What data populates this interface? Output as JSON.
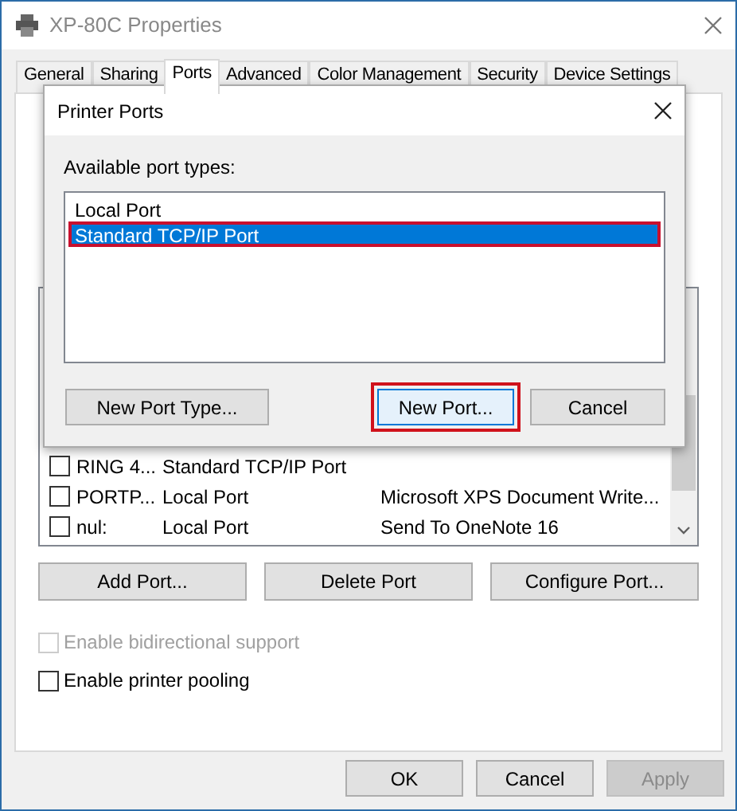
{
  "window": {
    "title": "XP-80C Properties"
  },
  "tabs": [
    {
      "label": "General",
      "selected": false
    },
    {
      "label": "Sharing",
      "selected": false
    },
    {
      "label": "Ports",
      "selected": true
    },
    {
      "label": "Advanced",
      "selected": false
    },
    {
      "label": "Color Management",
      "selected": false
    },
    {
      "label": "Security",
      "selected": false
    },
    {
      "label": "Device Settings",
      "selected": false
    }
  ],
  "ports": [
    {
      "port": "RING 4...",
      "description": "Standard TCP/IP Port",
      "checked": false
    },
    {
      "port": "PORTP...",
      "description": "Local Port",
      "printer": "Microsoft XPS Document Write...",
      "checked": false
    },
    {
      "port": "nul:",
      "description": "Local Port",
      "printer": "Send To OneNote 16",
      "checked": false
    }
  ],
  "port_buttons": [
    "Add Port...",
    "Delete Port",
    "Configure Port..."
  ],
  "options": [
    {
      "label": "Enable bidirectional support",
      "checked": false,
      "disabled": true
    },
    {
      "label": "Enable printer pooling",
      "checked": false,
      "disabled": false
    }
  ],
  "buttons": [
    {
      "label": "OK",
      "disabled": false
    },
    {
      "label": "Cancel",
      "disabled": false
    },
    {
      "label": "Apply",
      "disabled": true
    }
  ],
  "dialog": {
    "title": "Printer Ports",
    "list_label": "Available port types:",
    "port_types": [
      {
        "label": "Local Port",
        "selected": false
      },
      {
        "label": "Standard TCP/IP Port",
        "selected": true
      }
    ],
    "buttons": [
      {
        "label": "New Port Type...",
        "highlighted": false,
        "focused": false
      },
      {
        "label": "New Port...",
        "highlighted": true,
        "focused": true
      },
      {
        "label": "Cancel",
        "highlighted": false,
        "focused": false
      }
    ]
  }
}
